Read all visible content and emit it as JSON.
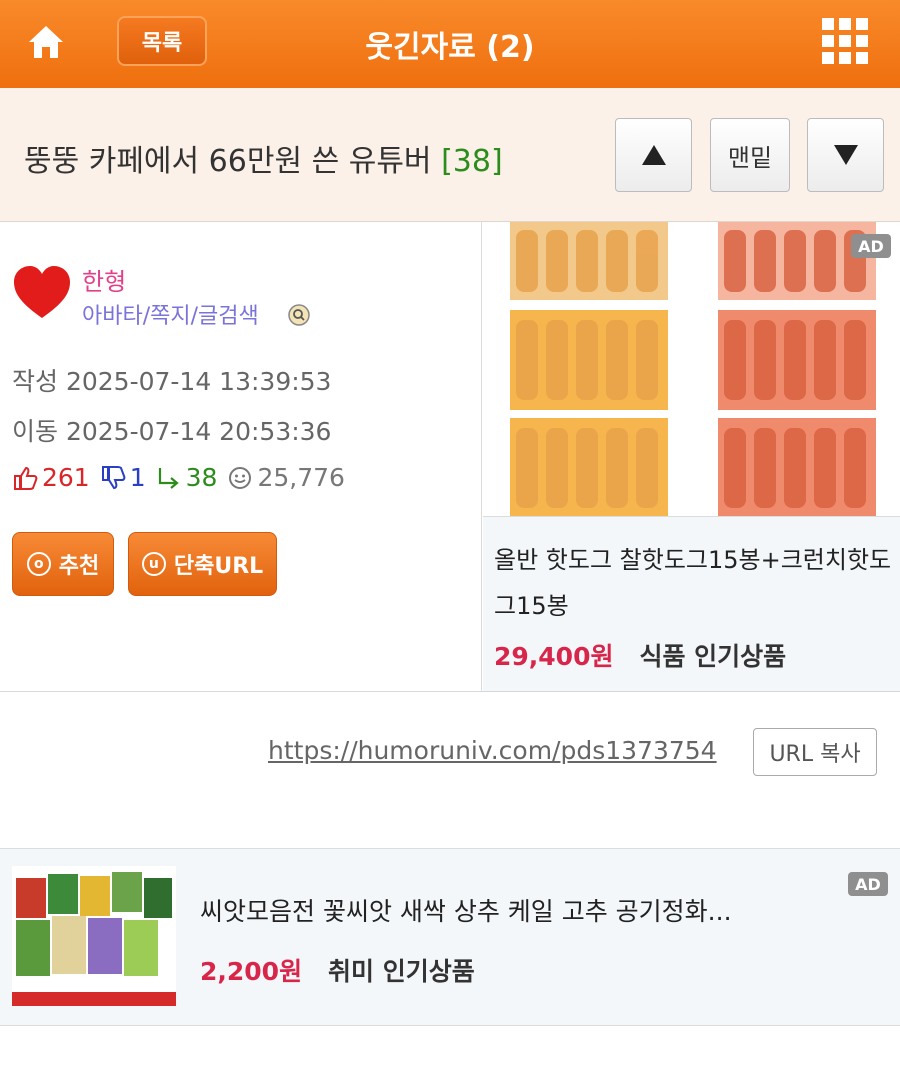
{
  "header": {
    "home_icon": "home-icon",
    "list_label": "목록",
    "title": "웃긴자료 (2)",
    "grid_icon": "grid-menu-icon"
  },
  "post": {
    "title": "뚱뚱 카페에서 66만원 쓴 유튜버",
    "comment_count": "[38]"
  },
  "nav": {
    "up_icon": "triangle-up-icon",
    "bottom_label": "맨밑",
    "down_icon": "triangle-down-icon"
  },
  "author": {
    "name": "한형",
    "links": "아바타/쪽지/글검색",
    "written": "작성 2025-07-14 13:39:53",
    "moved": "이동 2025-07-14 20:53:36"
  },
  "stats": {
    "likes": "261",
    "dislikes": "1",
    "replies": "38",
    "views": "25,776"
  },
  "actions": {
    "recommend": "추천",
    "recommend_icon": "ⓞ",
    "short_url": "단축URL",
    "short_url_icon": "ⓤ"
  },
  "ad1": {
    "badge": "AD",
    "name": "올반 핫도그 찰핫도그15봉+크런치핫도그15봉",
    "price": "29,400원",
    "category": "식품 인기상품"
  },
  "link": {
    "url": "https://humoruniv.com/pds1373754",
    "copy_label": "URL 복사"
  },
  "ad2": {
    "badge": "AD",
    "name": "씨앗모음전 꽃씨앗 새싹 상추 케일 고추 공기정화...",
    "price": "2,200원",
    "category": "취미 인기상품"
  },
  "colors": {
    "header": "#f2761a",
    "title_bg": "#fbf1e9",
    "price": "#d8264b",
    "author": "#e2418a"
  }
}
